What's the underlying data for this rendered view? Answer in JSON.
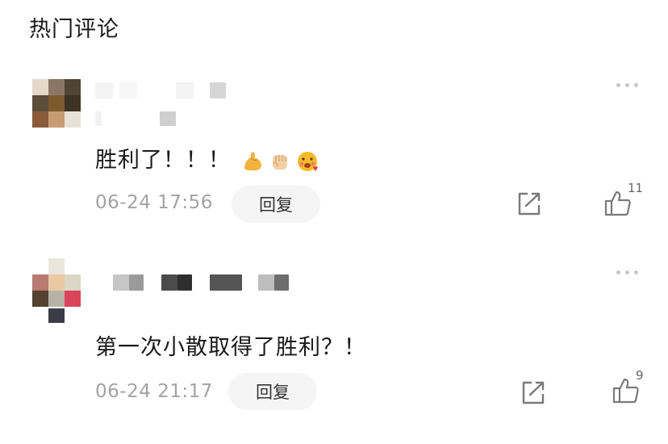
{
  "section": {
    "title": "热门评论"
  },
  "comments": [
    {
      "text": "胜利了！！！",
      "emoji": [
        "flexed-biceps",
        "raised-fist",
        "face-blowing-kiss"
      ],
      "time": "06-24 17:56",
      "reply_label": "回复",
      "likes": "11"
    },
    {
      "text": "第一次小散取得了胜利？！",
      "time": "06-24 21:17",
      "reply_label": "回复",
      "likes": "9"
    }
  ],
  "colors": {
    "text": "#1a1a1a",
    "meta": "#a3a3a3",
    "reply_bg": "#f5f5f5",
    "icon_stroke": "#7a7a7a",
    "dots": "#c7c7c7"
  }
}
